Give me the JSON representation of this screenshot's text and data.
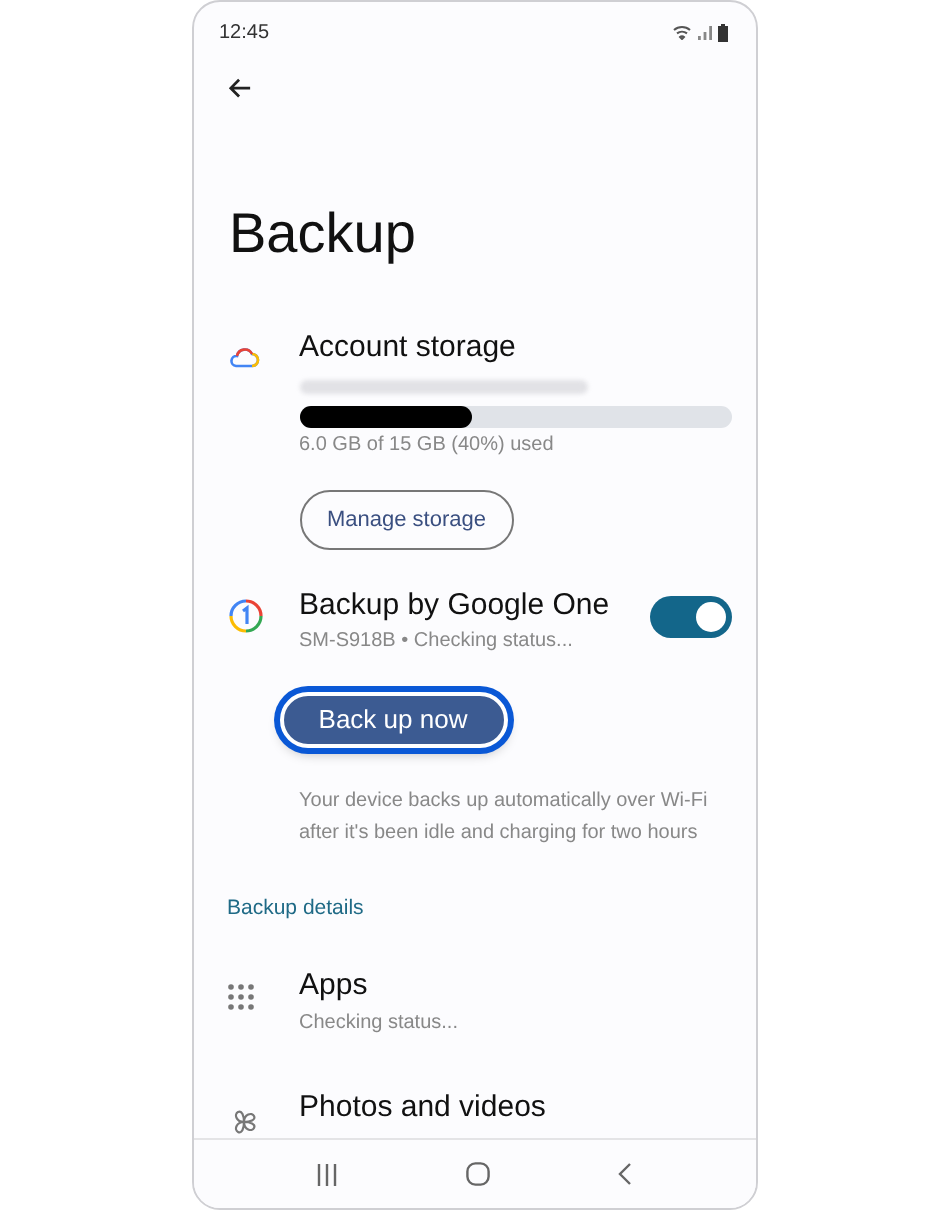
{
  "status_bar": {
    "time": "12:45"
  },
  "title": "Backup",
  "account_storage": {
    "title": "Account storage",
    "level": 0.4,
    "usage": "6.0 GB of 15 GB (40%) used",
    "button": "Manage storage"
  },
  "backup_one": {
    "title": "Backup by Google One",
    "subtitle": "SM-S918B • Checking status...",
    "on": true
  },
  "back_up_now": {
    "label": "Back up now",
    "focused": true
  },
  "description": "Your device backs up automatically over Wi-Fi after it's been idle and charging for two hours",
  "section_header": "Backup details",
  "details": [
    {
      "kind": "apps",
      "title": "Apps",
      "subtitle": "Checking status..."
    },
    {
      "kind": "photos",
      "title": "Photos and videos"
    }
  ]
}
